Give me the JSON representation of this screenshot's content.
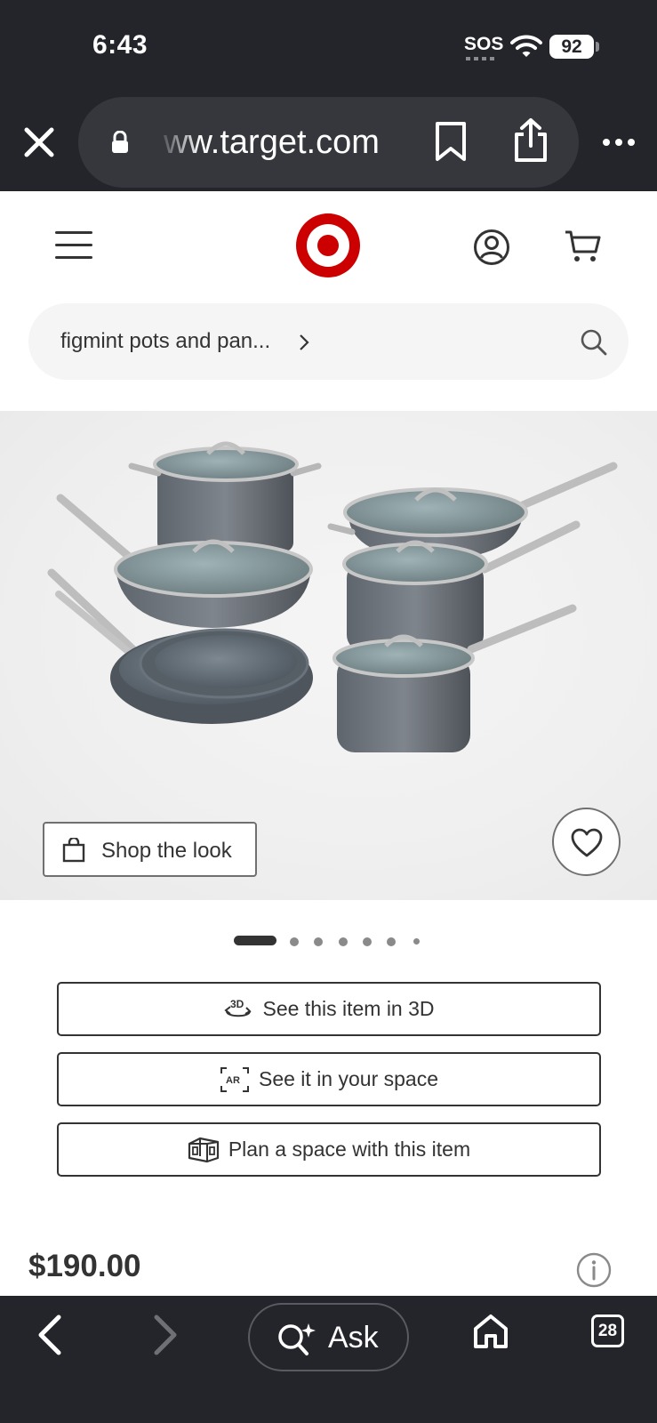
{
  "status_bar": {
    "time": "6:43",
    "carrier_status": "SOS",
    "battery": "92"
  },
  "browser": {
    "url": "ww.target.com",
    "tabs_count": "28",
    "ask_label": "Ask"
  },
  "header": {
    "search_query": "figmint pots and pan..."
  },
  "gallery": {
    "shop_the_look_label": "Shop the look",
    "slide_count": 7,
    "active_slide": 1
  },
  "actions": {
    "view_3d_label": "See this item in 3D",
    "ar_label": "See it in your space",
    "plan_label": "Plan a space with this item"
  },
  "product": {
    "price": "$190.00"
  },
  "icons": {
    "close": "close-icon",
    "lock": "lock-icon",
    "bookmark": "bookmark-icon",
    "share": "share-icon",
    "more": "more-icon",
    "menu": "menu-icon",
    "logo": "target-logo",
    "account": "account-icon",
    "cart": "cart-icon",
    "search": "search-icon",
    "favorite": "heart-icon",
    "info": "info-icon",
    "back": "back-icon",
    "forward": "forward-icon",
    "home": "home-icon"
  },
  "colors": {
    "brand_red": "#cc0000",
    "chrome_bg": "#24252b",
    "text_dark": "#333333"
  }
}
